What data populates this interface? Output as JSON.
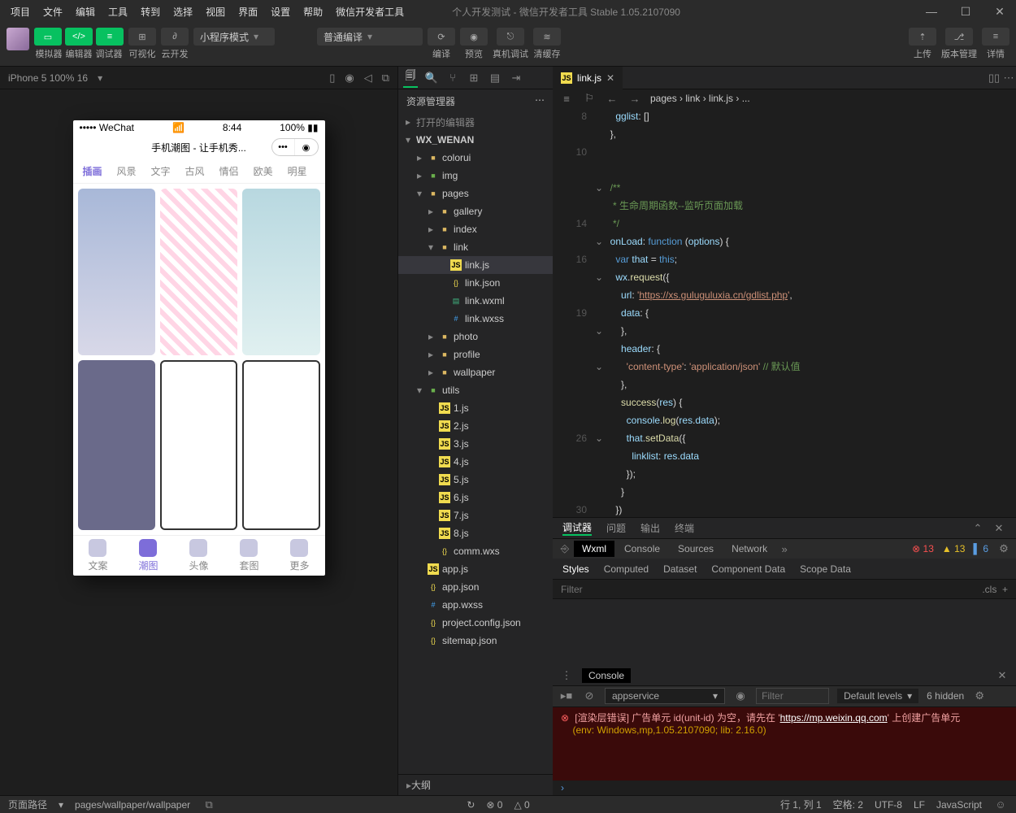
{
  "menu": [
    "项目",
    "文件",
    "编辑",
    "工具",
    "转到",
    "选择",
    "视图",
    "界面",
    "设置",
    "帮助",
    "微信开发者工具"
  ],
  "title": "个人开发测试 - 微信开发者工具 Stable 1.05.2107090",
  "toolbar": {
    "labels": [
      "模拟器",
      "编辑器",
      "调试器",
      "可视化",
      "云开发"
    ],
    "mode": "小程序模式",
    "compile": "普通编译",
    "actions": [
      "编译",
      "预览",
      "真机调试",
      "清缓存"
    ],
    "right": [
      "上传",
      "版本管理",
      "详情"
    ]
  },
  "sim": {
    "device": "iPhone 5 100% 16"
  },
  "phone": {
    "carrier": "••••• WeChat",
    "time": "8:44",
    "battery": "100%",
    "title": "手机潮图 - 让手机秀...",
    "tabs": [
      "插画",
      "风景",
      "文字",
      "古风",
      "情侣",
      "欧美",
      "明星"
    ],
    "nav": [
      "文案",
      "潮图",
      "头像",
      "套图",
      "更多"
    ]
  },
  "explorer": {
    "title": "资源管理器",
    "sections": [
      "打开的编辑器",
      "WX_WENAN"
    ],
    "tree": [
      {
        "d": 1,
        "t": "folder",
        "n": "colorui"
      },
      {
        "d": 1,
        "t": "folder-g",
        "n": "img"
      },
      {
        "d": 1,
        "t": "folder",
        "n": "pages",
        "open": true
      },
      {
        "d": 2,
        "t": "folder",
        "n": "gallery"
      },
      {
        "d": 2,
        "t": "folder",
        "n": "index"
      },
      {
        "d": 2,
        "t": "folder",
        "n": "link",
        "open": true
      },
      {
        "d": 3,
        "t": "js",
        "n": "link.js",
        "sel": true
      },
      {
        "d": 3,
        "t": "json",
        "n": "link.json"
      },
      {
        "d": 3,
        "t": "wxml",
        "n": "link.wxml"
      },
      {
        "d": 3,
        "t": "wxss",
        "n": "link.wxss"
      },
      {
        "d": 2,
        "t": "folder",
        "n": "photo"
      },
      {
        "d": 2,
        "t": "folder",
        "n": "profile"
      },
      {
        "d": 2,
        "t": "folder",
        "n": "wallpaper"
      },
      {
        "d": 1,
        "t": "folder-g",
        "n": "utils",
        "open": true
      },
      {
        "d": 2,
        "t": "js",
        "n": "1.js"
      },
      {
        "d": 2,
        "t": "js",
        "n": "2.js"
      },
      {
        "d": 2,
        "t": "js",
        "n": "3.js"
      },
      {
        "d": 2,
        "t": "js",
        "n": "4.js"
      },
      {
        "d": 2,
        "t": "js",
        "n": "5.js"
      },
      {
        "d": 2,
        "t": "js",
        "n": "6.js"
      },
      {
        "d": 2,
        "t": "js",
        "n": "7.js"
      },
      {
        "d": 2,
        "t": "js",
        "n": "8.js"
      },
      {
        "d": 2,
        "t": "json",
        "n": "comm.wxs"
      },
      {
        "d": 1,
        "t": "js",
        "n": "app.js"
      },
      {
        "d": 1,
        "t": "json",
        "n": "app.json"
      },
      {
        "d": 1,
        "t": "wxss",
        "n": "app.wxss"
      },
      {
        "d": 1,
        "t": "json",
        "n": "project.config.json"
      },
      {
        "d": 1,
        "t": "json",
        "n": "sitemap.json"
      }
    ],
    "outline": "大纲"
  },
  "editor": {
    "tab": "link.js",
    "breadcrumb": "pages › link › link.js › ...",
    "lines": [
      8,
      "",
      10,
      "",
      "",
      "",
      14,
      "",
      16,
      "",
      "",
      19,
      "",
      "",
      "",
      "",
      "",
      "",
      26,
      "",
      "",
      "",
      30,
      ""
    ]
  },
  "debugger": {
    "tabs": [
      "调试器",
      "问题",
      "输出",
      "终端"
    ],
    "devtabs": [
      "Wxml",
      "Console",
      "Sources",
      "Network"
    ],
    "badges": {
      "err": "13",
      "warn": "13",
      "info": "6"
    },
    "styleTabs": [
      "Styles",
      "Computed",
      "Dataset",
      "Component Data",
      "Scope Data"
    ],
    "filter": "Filter",
    "cls": ".cls",
    "console": {
      "title": "Console",
      "context": "appservice",
      "levels": "Default levels",
      "hidden": "6 hidden",
      "msg1": "[渲染层错误] 广告单元 id(unit-id) 为空，请先在 '",
      "link": "https://mp.weixin.qq.com",
      "msg1b": "' 上创建广告单元",
      "msg2": "(env: Windows,mp,1.05.2107090; lib: 2.16.0)"
    }
  },
  "status": {
    "path_label": "页面路径",
    "path": "pages/wallpaper/wallpaper",
    "circles": "0",
    "tri": "0",
    "pos": "行 1, 列 1",
    "spaces": "空格: 2",
    "enc": "UTF-8",
    "eol": "LF",
    "lang": "JavaScript"
  }
}
